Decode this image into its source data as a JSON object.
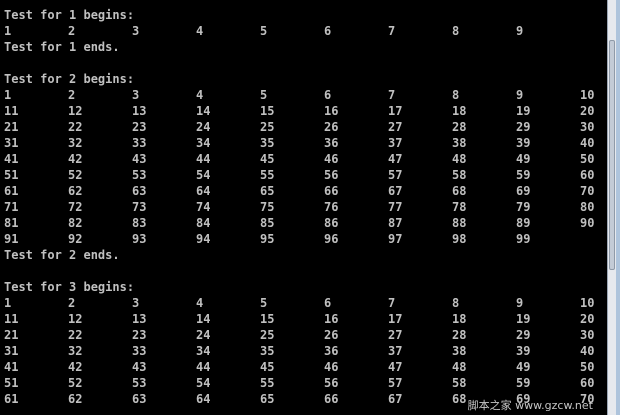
{
  "console": {
    "text_color": "#c0c0c0",
    "background_color": "#000000",
    "lines": [
      {
        "text": "Test for 1 begins:"
      },
      {
        "cells": [
          "1",
          "2",
          "3",
          "4",
          "5",
          "6",
          "7",
          "8",
          "9"
        ]
      },
      {
        "text": "Test for 1 ends."
      },
      {
        "text": ""
      },
      {
        "text": "Test for 2 begins:"
      },
      {
        "cells": [
          "1",
          "2",
          "3",
          "4",
          "5",
          "6",
          "7",
          "8",
          "9",
          "10"
        ]
      },
      {
        "cells": [
          "11",
          "12",
          "13",
          "14",
          "15",
          "16",
          "17",
          "18",
          "19",
          "20"
        ]
      },
      {
        "cells": [
          "21",
          "22",
          "23",
          "24",
          "25",
          "26",
          "27",
          "28",
          "29",
          "30"
        ]
      },
      {
        "cells": [
          "31",
          "32",
          "33",
          "34",
          "35",
          "36",
          "37",
          "38",
          "39",
          "40"
        ]
      },
      {
        "cells": [
          "41",
          "42",
          "43",
          "44",
          "45",
          "46",
          "47",
          "48",
          "49",
          "50"
        ]
      },
      {
        "cells": [
          "51",
          "52",
          "53",
          "54",
          "55",
          "56",
          "57",
          "58",
          "59",
          "60"
        ]
      },
      {
        "cells": [
          "61",
          "62",
          "63",
          "64",
          "65",
          "66",
          "67",
          "68",
          "69",
          "70"
        ]
      },
      {
        "cells": [
          "71",
          "72",
          "73",
          "74",
          "75",
          "76",
          "77",
          "78",
          "79",
          "80"
        ]
      },
      {
        "cells": [
          "81",
          "82",
          "83",
          "84",
          "85",
          "86",
          "87",
          "88",
          "89",
          "90"
        ]
      },
      {
        "cells": [
          "91",
          "92",
          "93",
          "94",
          "95",
          "96",
          "97",
          "98",
          "99"
        ]
      },
      {
        "text": "Test for 2 ends."
      },
      {
        "text": ""
      },
      {
        "text": "Test for 3 begins:"
      },
      {
        "cells": [
          "1",
          "2",
          "3",
          "4",
          "5",
          "6",
          "7",
          "8",
          "9",
          "10"
        ]
      },
      {
        "cells": [
          "11",
          "12",
          "13",
          "14",
          "15",
          "16",
          "17",
          "18",
          "19",
          "20"
        ]
      },
      {
        "cells": [
          "21",
          "22",
          "23",
          "24",
          "25",
          "26",
          "27",
          "28",
          "29",
          "30"
        ]
      },
      {
        "cells": [
          "31",
          "32",
          "33",
          "34",
          "35",
          "36",
          "37",
          "38",
          "39",
          "40"
        ]
      },
      {
        "cells": [
          "41",
          "42",
          "43",
          "44",
          "45",
          "46",
          "47",
          "48",
          "49",
          "50"
        ]
      },
      {
        "cells": [
          "51",
          "52",
          "53",
          "54",
          "55",
          "56",
          "57",
          "58",
          "59",
          "60"
        ]
      },
      {
        "cells": [
          "61",
          "62",
          "63",
          "64",
          "65",
          "66",
          "67",
          "68",
          "69",
          "70"
        ]
      }
    ]
  },
  "watermark": {
    "text": "脚本之家 www.gzcw.net"
  }
}
